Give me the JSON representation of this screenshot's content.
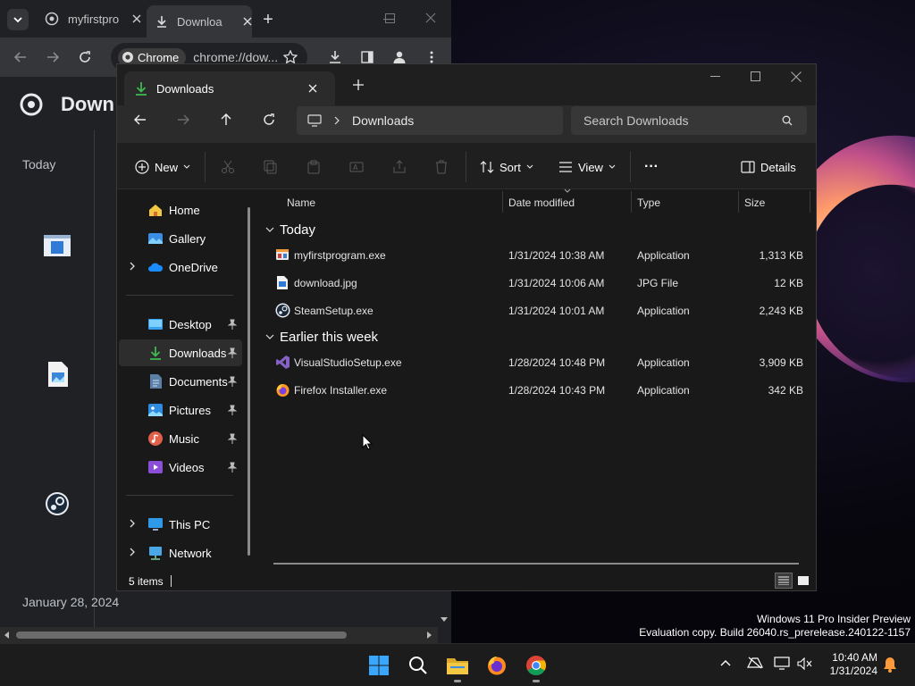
{
  "chrome": {
    "tabs": [
      {
        "label": "myfirstpro"
      },
      {
        "label": "Downloa"
      }
    ],
    "new_tab": "+",
    "omnibox": {
      "chip": "Chrome",
      "url": "chrome://dow..."
    },
    "page_title": "Down",
    "date_today": "Today",
    "date_earlier": "January 28, 2024"
  },
  "explorer": {
    "tab_title": "Downloads",
    "breadcrumb": [
      "Downloads"
    ],
    "search_placeholder": "Search Downloads",
    "commands": {
      "new": "New",
      "sort": "Sort",
      "view": "View",
      "more": "···",
      "details": "Details"
    },
    "nav": {
      "quick": [
        {
          "label": "Home",
          "icon": "home-icon"
        },
        {
          "label": "Gallery",
          "icon": "gallery-icon"
        },
        {
          "label": "OneDrive",
          "icon": "onedrive-icon"
        }
      ],
      "pinned": [
        {
          "label": "Desktop",
          "icon": "desktop-folder-icon"
        },
        {
          "label": "Downloads",
          "icon": "downloads-folder-icon"
        },
        {
          "label": "Documents",
          "icon": "documents-folder-icon"
        },
        {
          "label": "Pictures",
          "icon": "pictures-folder-icon"
        },
        {
          "label": "Music",
          "icon": "music-folder-icon"
        },
        {
          "label": "Videos",
          "icon": "videos-folder-icon"
        }
      ],
      "system": [
        {
          "label": "This PC",
          "icon": "this-pc-icon"
        },
        {
          "label": "Network",
          "icon": "network-icon"
        }
      ]
    },
    "columns": {
      "name": "Name",
      "date": "Date modified",
      "type": "Type",
      "size": "Size"
    },
    "groups": [
      {
        "title": "Today",
        "files": [
          {
            "name": "myfirstprogram.exe",
            "date": "1/31/2024 10:38 AM",
            "type": "Application",
            "size": "1,313 KB",
            "icon": "exe-icon"
          },
          {
            "name": "download.jpg",
            "date": "1/31/2024 10:06 AM",
            "type": "JPG File",
            "size": "12 KB",
            "icon": "image-file-icon"
          },
          {
            "name": "SteamSetup.exe",
            "date": "1/31/2024 10:01 AM",
            "type": "Application",
            "size": "2,243 KB",
            "icon": "steam-icon"
          }
        ]
      },
      {
        "title": "Earlier this week",
        "files": [
          {
            "name": "VisualStudioSetup.exe",
            "date": "1/28/2024 10:48 PM",
            "type": "Application",
            "size": "3,909 KB",
            "icon": "visual-studio-icon"
          },
          {
            "name": "Firefox Installer.exe",
            "date": "1/28/2024 10:43 PM",
            "type": "Application",
            "size": "342 KB",
            "icon": "firefox-icon"
          }
        ]
      }
    ],
    "status": "5 items"
  },
  "watermark": {
    "line1": "Windows 11 Pro Insider Preview",
    "line2": "Evaluation copy. Build 26040.rs_prerelease.240122-1157"
  },
  "taskbar": {
    "time": "10:40 AM",
    "date": "1/31/2024"
  },
  "colors": {
    "accent": "#4cc2ff",
    "download_green": "#3fb950",
    "folder_yellow": "#f3c744"
  }
}
